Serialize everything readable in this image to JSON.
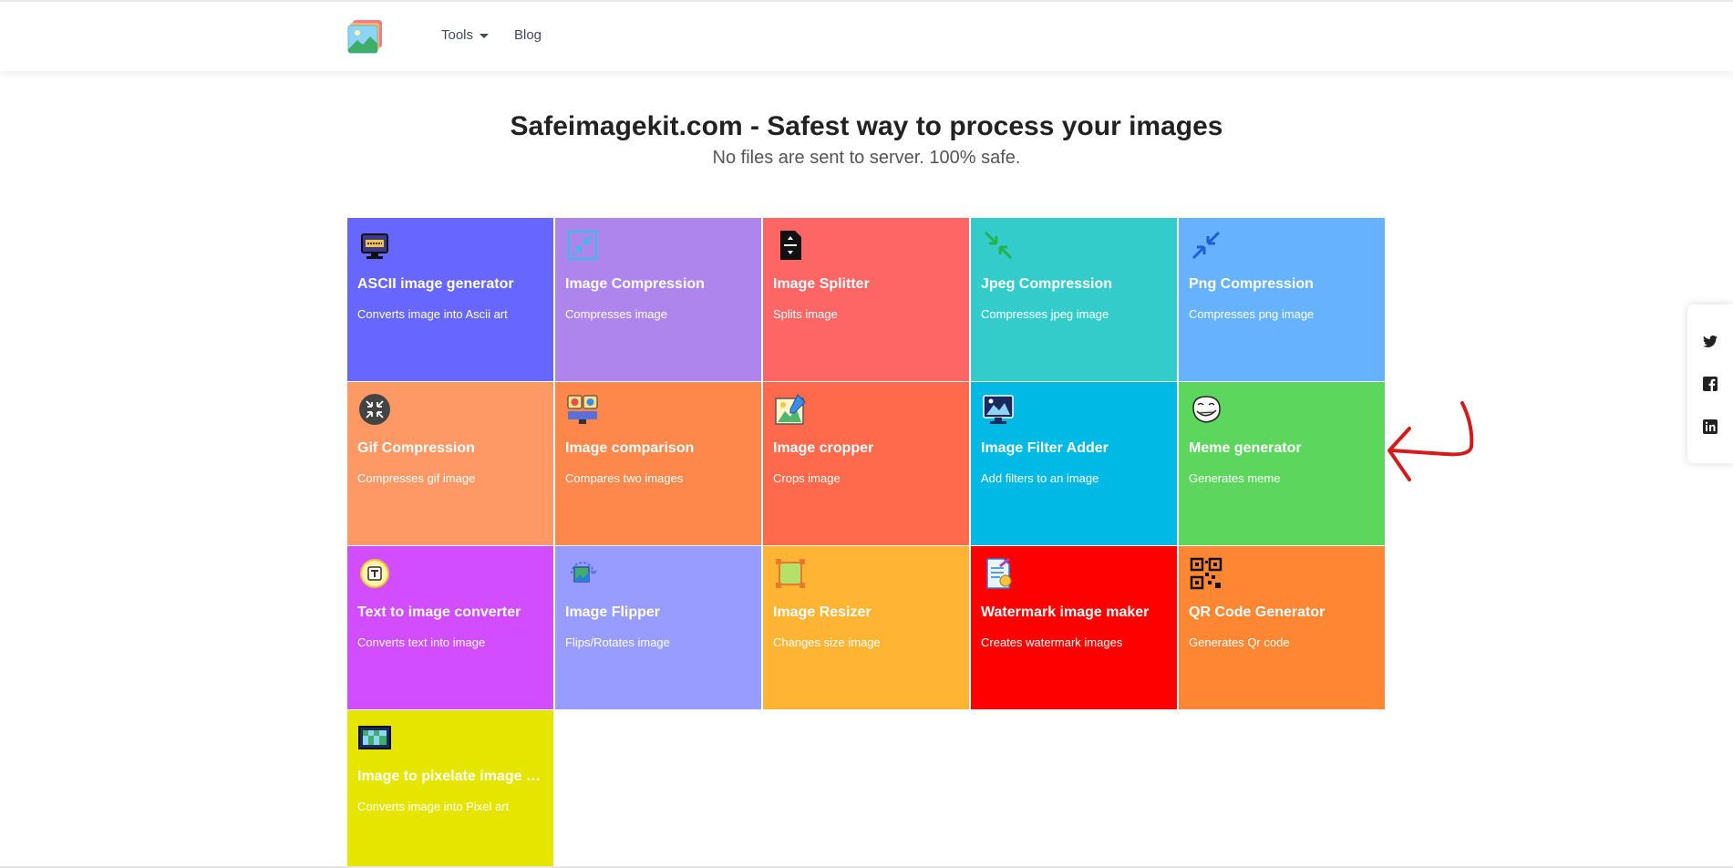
{
  "nav": {
    "tools_label": "Tools",
    "blog_label": "Blog"
  },
  "hero": {
    "title": "Safeimagekit.com - Safest way to process your images",
    "subtitle": "No files are sent to server. 100% safe."
  },
  "tools": [
    {
      "title": "ASCII image generator",
      "desc": "Converts image into Ascii art",
      "color": "#6766ff",
      "icon": "ascii-monitor-icon"
    },
    {
      "title": "Image Compression",
      "desc": "Compresses image",
      "color": "#ad85ed",
      "icon": "compress-arrows-icon"
    },
    {
      "title": "Image Splitter",
      "desc": "Splits image",
      "color": "#fe6565",
      "icon": "split-file-icon"
    },
    {
      "title": "Jpeg Compression",
      "desc": "Compresses jpeg image",
      "color": "#34cbcb",
      "icon": "jpeg-compress-icon"
    },
    {
      "title": "Png Compression",
      "desc": "Compresses png image",
      "color": "#66b2fe",
      "icon": "png-compress-icon"
    },
    {
      "title": "Gif Compression",
      "desc": "Compresses gif image",
      "color": "#fe9966",
      "icon": "gif-compress-icon"
    },
    {
      "title": "Image comparison",
      "desc": "Compares two images",
      "color": "#fe884b",
      "icon": "compare-screens-icon"
    },
    {
      "title": "Image cropper",
      "desc": "Crops image",
      "color": "#ff6a4d",
      "icon": "crop-picture-icon"
    },
    {
      "title": "Image Filter Adder",
      "desc": "Add filters to an image",
      "color": "#00b9e4",
      "icon": "filter-monitor-icon"
    },
    {
      "title": "Meme generator",
      "desc": "Generates meme",
      "color": "#5cd65c",
      "icon": "troll-face-icon"
    },
    {
      "title": "Text to image converter",
      "desc": "Converts text into image",
      "color": "#d24dff",
      "icon": "text-badge-icon"
    },
    {
      "title": "Image Flipper",
      "desc": "Flips/Rotates image",
      "color": "#989cff",
      "icon": "rotate-image-icon"
    },
    {
      "title": "Image Resizer",
      "desc": "Changes size image",
      "color": "#ffb533",
      "icon": "resize-square-icon"
    },
    {
      "title": "Watermark image maker",
      "desc": "Creates watermark images",
      "color": "#ff0000",
      "icon": "watermark-doc-icon"
    },
    {
      "title": "QR Code Generator",
      "desc": "Generates Qr code",
      "color": "#ff8733",
      "icon": "qr-code-icon"
    },
    {
      "title": "Image to pixelate image converter",
      "desc": "Converts image into Pixel art",
      "color": "#e5e500",
      "icon": "pixel-image-icon"
    }
  ],
  "social": [
    "twitter-icon",
    "facebook-icon",
    "linkedin-icon"
  ],
  "colors": {
    "annotation": "#d41b1b",
    "nav_text": "#404a54"
  }
}
